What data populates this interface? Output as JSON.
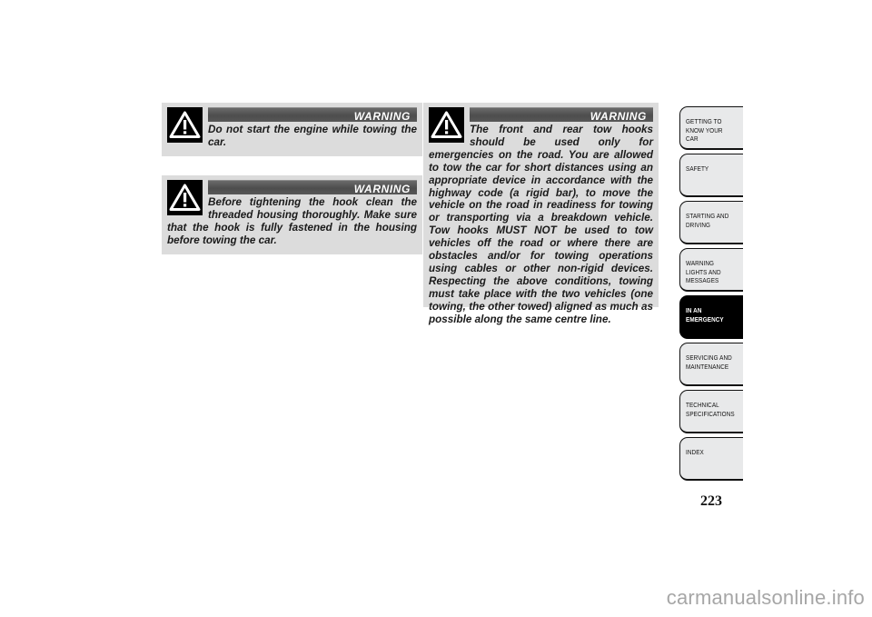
{
  "document": {
    "page_number": "223",
    "watermark": "carmanualsonline.info"
  },
  "warnings": [
    {
      "id": "warning-towing-engine",
      "title": "WARNING",
      "icon": "warning-triangle-icon",
      "text": "Do not start the engine while towing the car."
    },
    {
      "id": "warning-hook-tightening",
      "title": "WARNING",
      "icon": "warning-triangle-icon",
      "text": "Before tightening the hook clean the threaded housing thoroughly. Make sure that the hook is fully fastened in the housing before towing the car."
    },
    {
      "id": "warning-tow-hooks-use",
      "title": "WARNING",
      "icon": "warning-triangle-icon",
      "text": "The front and rear tow hooks should be used only for emergencies on the road. You are allowed to tow the car for short distances using an appropriate device in accordance with the highway code (a rigid bar), to move the vehicle on the road in readiness for towing or transporting via a breakdown vehicle. Tow hooks MUST NOT be used to tow vehicles off the road or where there are obstacles and/or for towing operations using cables or other non-rigid devices. Respecting the above conditions, towing must take place with the two vehicles (one towing, the other towed) aligned as much as possible along the same centre line."
    }
  ],
  "side_tabs": {
    "active_index": 4,
    "items": [
      {
        "label": "GETTING TO KNOW YOUR CAR"
      },
      {
        "label": "SAFETY"
      },
      {
        "label": "STARTING AND DRIVING"
      },
      {
        "label": "WARNING LIGHTS AND MESSAGES"
      },
      {
        "label": "IN AN EMERGENCY"
      },
      {
        "label": "SERVICING AND MAINTENANCE"
      },
      {
        "label": "TECHNICAL SPECIFICATIONS"
      },
      {
        "label": "INDEX"
      }
    ]
  },
  "colors": {
    "warning_box_bg": "#dcdcdc",
    "warning_header_bar": "#555555",
    "tab_bg": "#e8e9ea",
    "tab_active_bg": "#000000",
    "watermark": "#a6a6a6"
  }
}
